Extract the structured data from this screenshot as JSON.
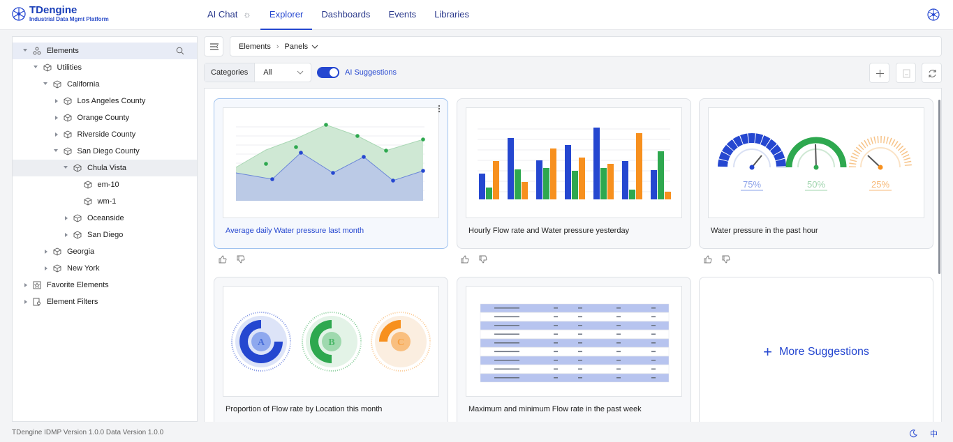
{
  "header": {
    "brand": "TDengine",
    "tagline": "Industrial Data Mgmt Platform",
    "nav": [
      {
        "label": "AI Chat",
        "icon": "lightbulb-icon"
      },
      {
        "label": "Explorer"
      },
      {
        "label": "Dashboards"
      },
      {
        "label": "Events"
      },
      {
        "label": "Libraries"
      }
    ],
    "active_nav": "Explorer"
  },
  "sidebar": {
    "tree": [
      {
        "label": "Elements",
        "icon": "elements-icon",
        "caret": "down"
      },
      {
        "label": "Utilities",
        "icon": "cube-icon",
        "caret": "down"
      },
      {
        "label": "California",
        "icon": "cube-icon",
        "caret": "down"
      },
      {
        "label": "Los Angeles County",
        "icon": "cube-icon",
        "caret": "right"
      },
      {
        "label": "Orange County",
        "icon": "cube-icon",
        "caret": "right"
      },
      {
        "label": "Riverside County",
        "icon": "cube-icon",
        "caret": "right"
      },
      {
        "label": "San Diego County",
        "icon": "cube-icon",
        "caret": "down"
      },
      {
        "label": "Chula Vista",
        "icon": "cube-icon",
        "caret": "down"
      },
      {
        "label": "em-10",
        "icon": "cube-icon",
        "caret": "none"
      },
      {
        "label": "wm-1",
        "icon": "cube-icon",
        "caret": "none"
      },
      {
        "label": "Oceanside",
        "icon": "cube-icon",
        "caret": "right"
      },
      {
        "label": "San Diego",
        "icon": "cube-icon",
        "caret": "right"
      },
      {
        "label": "Georgia",
        "icon": "cube-icon",
        "caret": "right"
      },
      {
        "label": "New York",
        "icon": "cube-icon",
        "caret": "right"
      },
      {
        "label": "Favorite Elements",
        "icon": "star-box-icon",
        "caret": "right"
      },
      {
        "label": "Element Filters",
        "icon": "filter-box-icon",
        "caret": "right"
      }
    ]
  },
  "main": {
    "breadcrumb": {
      "root": "Elements",
      "current": "Panels"
    },
    "categories_label": "Categories",
    "category_value": "All",
    "ai_toggle_label": "AI Suggestions",
    "ai_toggle_on": true,
    "cards": [
      {
        "title": "Average daily Water pressure last month",
        "thumb": "area-line",
        "selected": true
      },
      {
        "title": "Hourly Flow rate and Water pressure yesterday",
        "thumb": "bars"
      },
      {
        "title": "Water pressure in the past hour",
        "thumb": "gauges",
        "gauge_labels": [
          "75%",
          "50%",
          "25%"
        ]
      },
      {
        "title": "Proportion of Flow rate by Location this month",
        "thumb": "donuts",
        "donut_labels": [
          "A",
          "B",
          "C"
        ]
      },
      {
        "title": "Maximum and minimum Flow rate in the past week",
        "thumb": "table"
      }
    ],
    "more_suggestions": "More Suggestions"
  },
  "footer": {
    "version": "TDengine IDMP Version 1.0.0 Data Version 1.0.0",
    "lang": "中"
  },
  "colors": {
    "accent": "#2547d0",
    "green": "#2ea84f",
    "orange": "#f7901e"
  }
}
